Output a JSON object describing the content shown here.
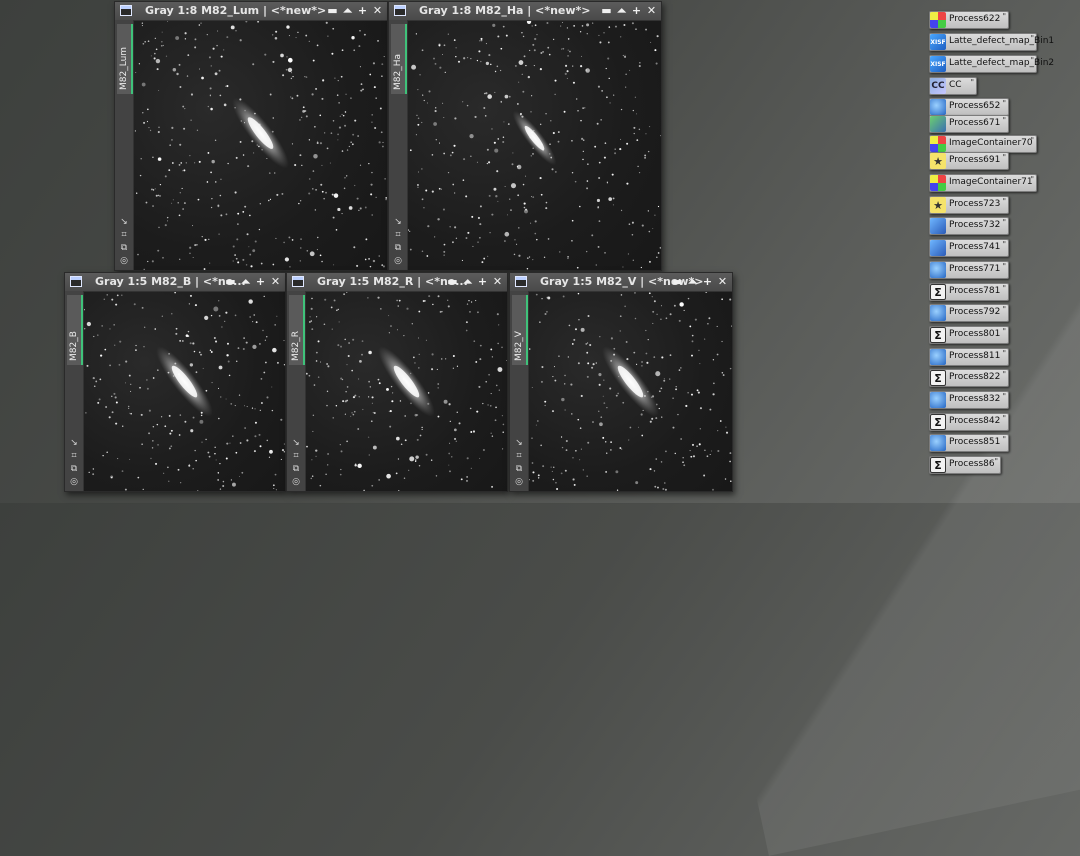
{
  "windows": [
    {
      "id": "lum",
      "title": "Gray 1:8 M82_Lum | <*new*>",
      "tab": "M82_Lum"
    },
    {
      "id": "ha",
      "title": "Gray 1:8 M82_Ha | <*new*>",
      "tab": "M82_Ha"
    },
    {
      "id": "b",
      "title": "Gray 1:5 M82_B | <*ne...",
      "tab": "M82_B"
    },
    {
      "id": "r",
      "title": "Gray 1:5 M82_R | <*ne...",
      "tab": "M82_R"
    },
    {
      "id": "v",
      "title": "Gray 1:5 M82_V | <*new*>",
      "tab": "M82_V"
    }
  ],
  "window_controls": {
    "shade": "▬",
    "collapse": "⏶",
    "maximize": "+",
    "close": "✕"
  },
  "side_icons": [
    "↘",
    "⌗",
    "⧉",
    "◎"
  ],
  "process_icons": [
    {
      "label": "Process622",
      "icon": "grid-icon",
      "style": "grid"
    },
    {
      "label": "Latte_defect_map_Bin1",
      "icon": "xisf-file-icon",
      "style": "xisf"
    },
    {
      "label": "Latte_defect_map_Bin2",
      "icon": "xisf-file-icon",
      "style": "xisf"
    },
    {
      "label": "CC",
      "icon": "cc-icon",
      "style": "cc"
    },
    {
      "label": "Process652",
      "icon": "globe-icon",
      "style": "globe"
    },
    {
      "label": "Process671",
      "icon": "green-icon",
      "style": "green"
    },
    {
      "label": "ImageContainer70",
      "icon": "grid-icon",
      "style": "grid"
    },
    {
      "label": "Process691",
      "icon": "star-icon",
      "style": "star"
    },
    {
      "label": "ImageContainer71",
      "icon": "grid-icon",
      "style": "grid"
    },
    {
      "label": "Process723",
      "icon": "star-icon",
      "style": "star"
    },
    {
      "label": "Process732",
      "icon": "blue-icon",
      "style": "blue"
    },
    {
      "label": "Process741",
      "icon": "blue-icon",
      "style": "blue"
    },
    {
      "label": "Process771",
      "icon": "globe-icon",
      "style": "globe"
    },
    {
      "label": "Process781",
      "icon": "sigma-icon",
      "style": "sigma"
    },
    {
      "label": "Process792",
      "icon": "globe-icon",
      "style": "globe"
    },
    {
      "label": "Process801",
      "icon": "sigma-icon",
      "style": "sigma"
    },
    {
      "label": "Process811",
      "icon": "globe-icon",
      "style": "globe"
    },
    {
      "label": "Process822",
      "icon": "sigma-icon",
      "style": "sigma"
    },
    {
      "label": "Process832",
      "icon": "globe-icon",
      "style": "globe"
    },
    {
      "label": "Process842",
      "icon": "sigma-icon",
      "style": "sigma"
    },
    {
      "label": "Process851",
      "icon": "globe-icon",
      "style": "globe"
    },
    {
      "label": "Process86",
      "icon": "sigma-icon",
      "style": "sigma"
    }
  ],
  "colors": {
    "tab_accent": "#3fc27a",
    "titlebar": "#555555",
    "icon_bg": "#cfcfcf"
  }
}
